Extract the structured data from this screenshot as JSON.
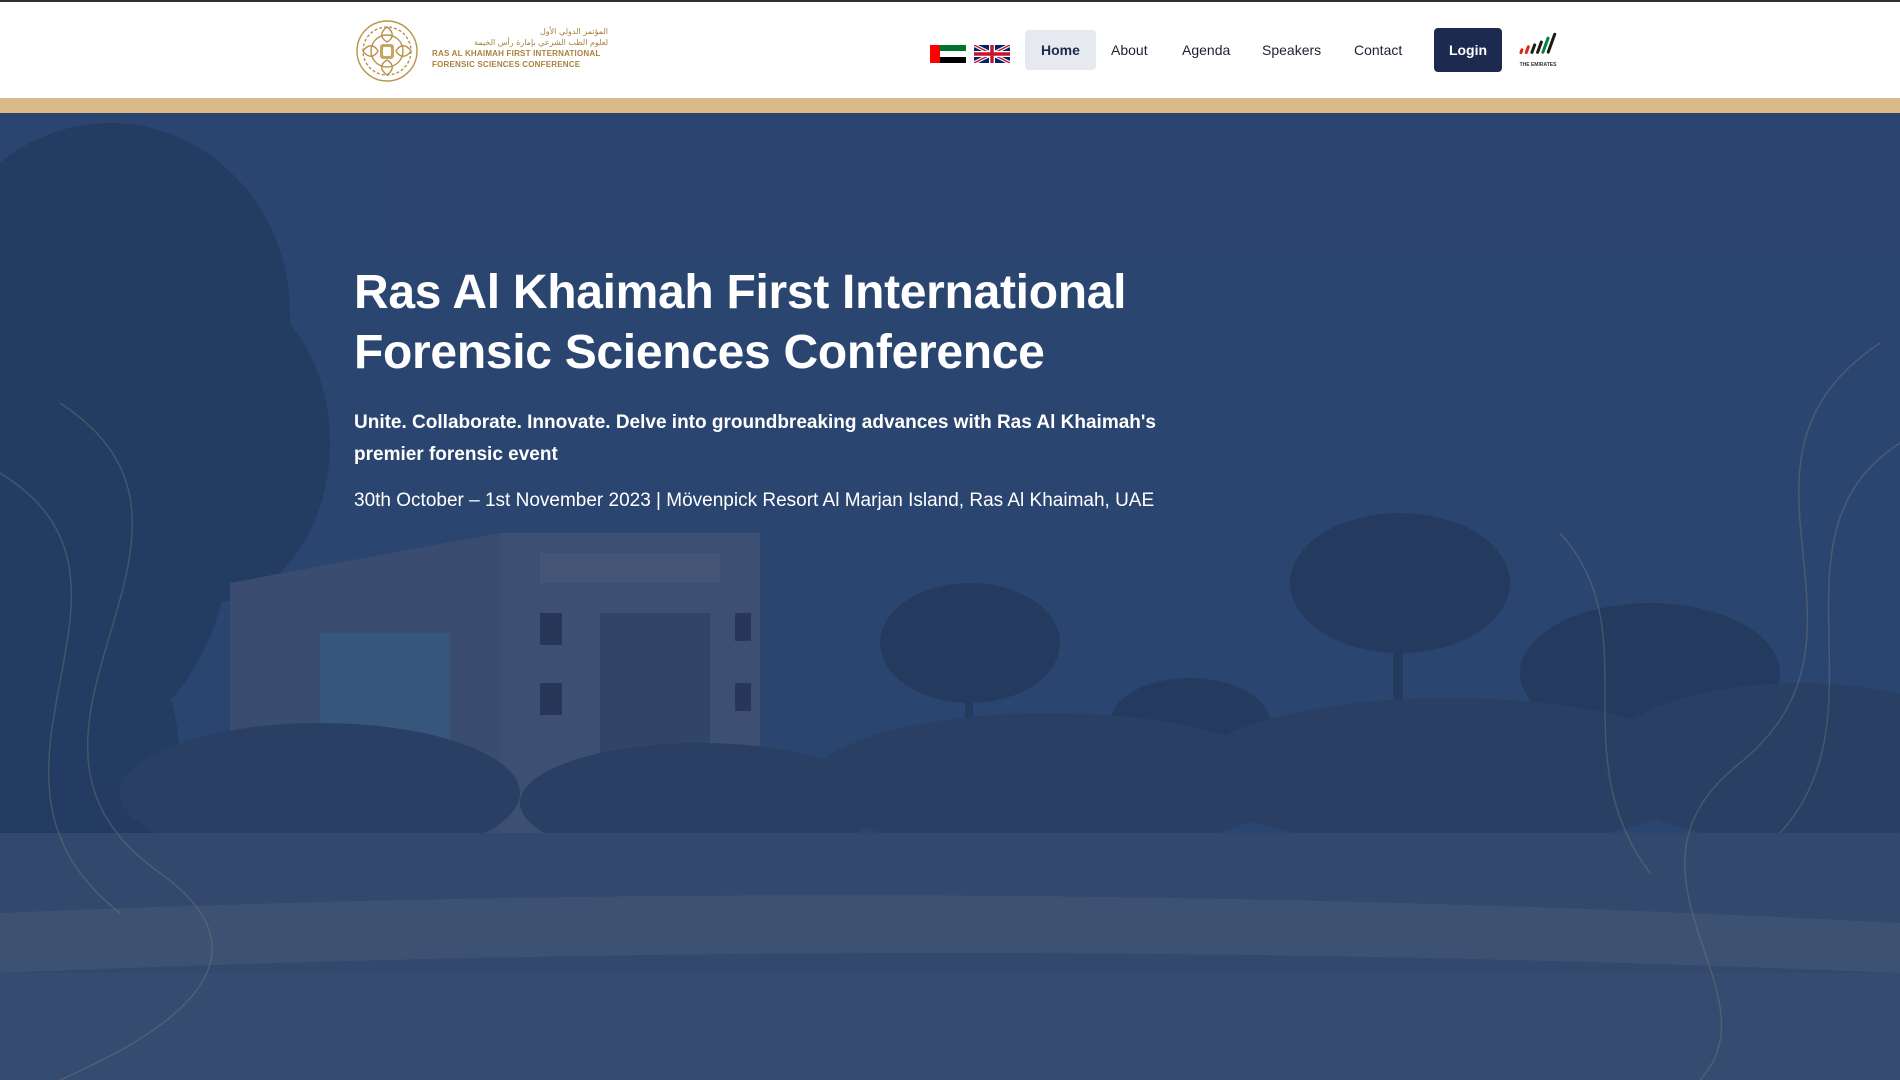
{
  "brand": {
    "arabic_line1": "المؤتمر الدولي الأول",
    "arabic_line2": "لعلوم الطب الشرعي بإمارة رأس الخيمة",
    "english_line1": "RAS AL KHAIMAH FIRST INTERNATIONAL",
    "english_line2": "FORENSIC SCIENCES CONFERENCE",
    "color": "#a8823c"
  },
  "language_flags": [
    "uae-flag-icon",
    "uk-flag-icon"
  ],
  "nav": {
    "items": [
      {
        "label": "Home",
        "active": true
      },
      {
        "label": "About",
        "active": false
      },
      {
        "label": "Agenda",
        "active": false
      },
      {
        "label": "Speakers",
        "active": false
      },
      {
        "label": "Contact",
        "active": false
      }
    ],
    "login_label": "Login",
    "emirates_logo_text": "THE EMIRATES"
  },
  "hero": {
    "title": "Ras Al Khaimah First International Forensic Sciences Conference",
    "subtitle": "Unite. Collaborate. Innovate. Delve into groundbreaking advances with Ras Al Khaimah's premier forensic event",
    "date_venue": "30th October – 1st November 2023 | Mövenpick Resort Al Marjan Island, Ras Al Khaimah, UAE"
  },
  "colors": {
    "primary_navy": "#1c2a4f",
    "gold_band": "#d8b987",
    "hero_overlay": "#2d4570",
    "nav_active_bg": "#e6e9ef"
  }
}
